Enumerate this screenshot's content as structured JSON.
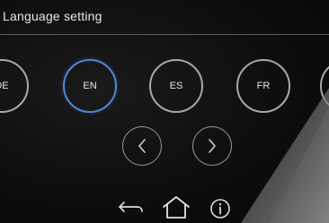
{
  "header": {
    "title": "Language setting"
  },
  "languages": [
    {
      "code": "DE",
      "selected": false
    },
    {
      "code": "EN",
      "selected": true
    },
    {
      "code": "ES",
      "selected": false
    },
    {
      "code": "FR",
      "selected": false
    }
  ],
  "navigation": {
    "prev_icon": "chevron-left-icon",
    "next_icon": "chevron-right-icon"
  },
  "bottom_bar": {
    "icons": [
      "back-arrow-icon",
      "home-icon",
      "info-icon"
    ]
  },
  "colors": {
    "accent": "#4f86d6",
    "ring": "#a8a8a8",
    "text": "#e8e8e8",
    "background": "#0d0d0e"
  }
}
